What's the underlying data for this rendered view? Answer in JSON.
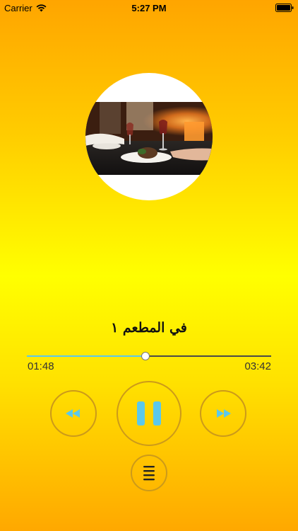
{
  "status_bar": {
    "carrier": "Carrier",
    "time": "5:27 PM",
    "wifi_icon": "wifi-icon",
    "battery_icon": "battery-icon"
  },
  "artwork": {
    "description_icon": "restaurant-photo"
  },
  "track": {
    "title": "في المطعم ١"
  },
  "player": {
    "elapsed": "01:48",
    "duration": "03:42",
    "progress_fraction": 0.486
  },
  "controls": {
    "rewind_icon": "rewind-icon",
    "pause_icon": "pause-icon",
    "forward_icon": "fast-forward-icon",
    "playlist_icon": "playlist-icon"
  },
  "colors": {
    "accent": "#5bc8ec",
    "button_ring": "#cc9a1a",
    "playlist_icon": "#222222",
    "bg_top": "#ffa500",
    "bg_middle": "#ffff00"
  }
}
